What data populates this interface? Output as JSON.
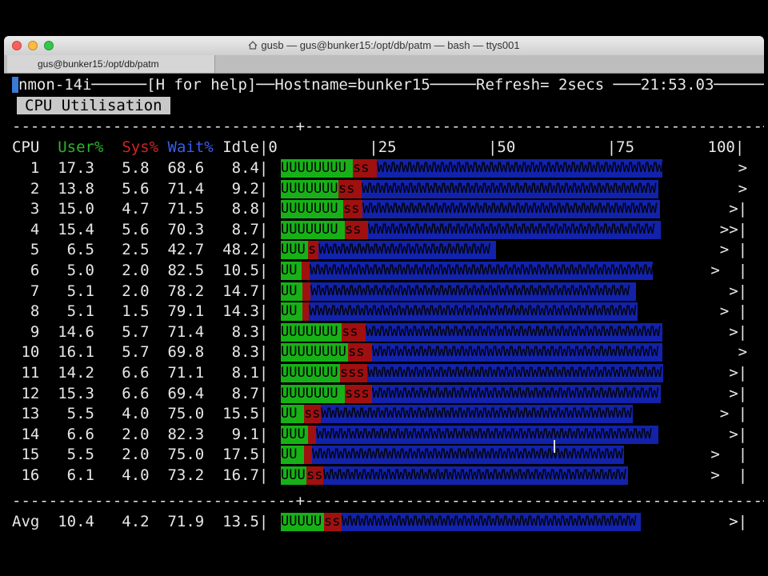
{
  "window": {
    "title": "gusb — gus@bunker15:/opt/db/patm — bash — ttys001",
    "tab": "gus@bunker15:/opt/db/patm"
  },
  "header": {
    "app": "nmon-14i",
    "help": "[H for help]",
    "hostname": "Hostname=bunker15",
    "refresh": "Refresh= 2secs",
    "time": "21:53.03"
  },
  "section": "CPU Utilisation",
  "columns": {
    "cpu": "CPU",
    "user": "User%",
    "sys": "Sys%",
    "wait": "Wait%",
    "idle": "Idle"
  },
  "scale": [
    "0",
    "|25",
    "|50",
    "|75",
    "100|"
  ],
  "rows": [
    {
      "cpu": "1",
      "user": "17.3",
      "sys": "5.8",
      "wait": "68.6",
      "idle": "8.4",
      "tail": ">"
    },
    {
      "cpu": "2",
      "user": "13.8",
      "sys": "5.6",
      "wait": "71.4",
      "idle": "9.2",
      "tail": ">"
    },
    {
      "cpu": "3",
      "user": "15.0",
      "sys": "4.7",
      "wait": "71.5",
      "idle": "8.8",
      "tail": ">|"
    },
    {
      "cpu": "4",
      "user": "15.4",
      "sys": "5.6",
      "wait": "70.3",
      "idle": "8.7",
      "tail": ">>|"
    },
    {
      "cpu": "5",
      "user": "6.5",
      "sys": "2.5",
      "wait": "42.7",
      "idle": "48.2",
      "tail": "> |"
    },
    {
      "cpu": "6",
      "user": "5.0",
      "sys": "2.0",
      "wait": "82.5",
      "idle": "10.5",
      "tail": ">  |"
    },
    {
      "cpu": "7",
      "user": "5.1",
      "sys": "2.0",
      "wait": "78.2",
      "idle": "14.7",
      "tail": ">|"
    },
    {
      "cpu": "8",
      "user": "5.1",
      "sys": "1.5",
      "wait": "79.1",
      "idle": "14.3",
      "tail": "> |"
    },
    {
      "cpu": "9",
      "user": "14.6",
      "sys": "5.7",
      "wait": "71.4",
      "idle": "8.3",
      "tail": ">|"
    },
    {
      "cpu": "10",
      "user": "16.1",
      "sys": "5.7",
      "wait": "69.8",
      "idle": "8.3",
      "tail": ">"
    },
    {
      "cpu": "11",
      "user": "14.2",
      "sys": "6.6",
      "wait": "71.1",
      "idle": "8.1",
      "tail": ">|"
    },
    {
      "cpu": "12",
      "user": "15.3",
      "sys": "6.6",
      "wait": "69.4",
      "idle": "8.7",
      "tail": ">|"
    },
    {
      "cpu": "13",
      "user": "5.5",
      "sys": "4.0",
      "wait": "75.0",
      "idle": "15.5",
      "tail": "> |"
    },
    {
      "cpu": "14",
      "user": "6.6",
      "sys": "2.0",
      "wait": "82.3",
      "idle": "9.1",
      "tail": ">|"
    },
    {
      "cpu": "15",
      "user": "5.5",
      "sys": "2.0",
      "wait": "75.0",
      "idle": "17.5",
      "tail": ">  |"
    },
    {
      "cpu": "16",
      "user": "6.1",
      "sys": "4.0",
      "wait": "73.2",
      "idle": "16.7",
      "tail": ">  |"
    }
  ],
  "avg": {
    "cpu": "Avg",
    "user": "10.4",
    "sys": "4.2",
    "wait": "71.9",
    "idle": "13.5",
    "tail": ">|"
  },
  "colors": {
    "user": "#17b117",
    "sys": "#a01010",
    "wait": "#1222aa"
  }
}
